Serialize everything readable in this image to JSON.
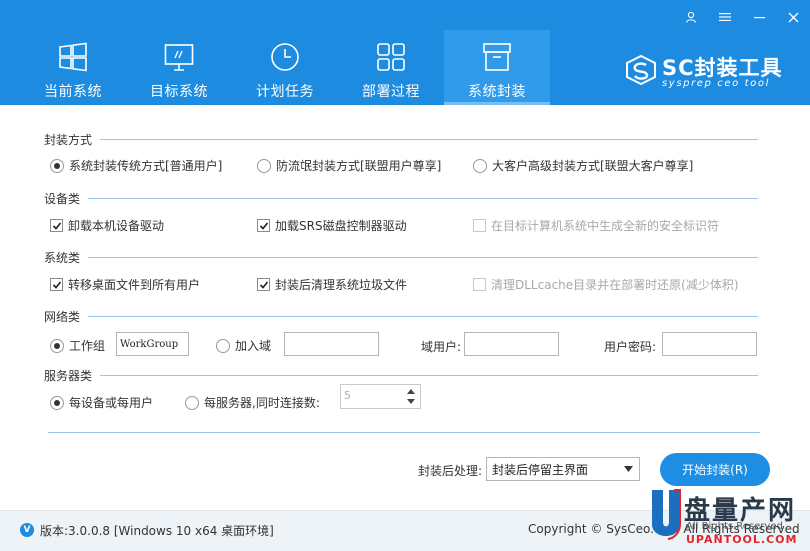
{
  "window": {
    "controls": [
      {
        "icon": "user-icon"
      },
      {
        "icon": "menu-icon"
      },
      {
        "icon": "minimize-icon"
      },
      {
        "icon": "close-icon"
      }
    ]
  },
  "tabs": [
    {
      "label": "当前系统",
      "icon": "windows-icon"
    },
    {
      "label": "目标系统",
      "icon": "monitor-icon"
    },
    {
      "label": "计划任务",
      "icon": "clock-icon"
    },
    {
      "label": "部署过程",
      "icon": "grid-icon"
    },
    {
      "label": "系统封装",
      "icon": "package-icon",
      "active": true
    }
  ],
  "brand": {
    "name": "SC封装工具",
    "sub": "sysprep ceo tool"
  },
  "sections": {
    "mode": {
      "title": "封装方式",
      "options": [
        {
          "label": "系统封装传统方式[普通用户]",
          "selected": true
        },
        {
          "label": "防流氓封装方式[联盟用户尊享]",
          "selected": false
        },
        {
          "label": "大客户高级封装方式[联盟大客户尊享]",
          "selected": false
        }
      ]
    },
    "device": {
      "title": "设备类",
      "options": [
        {
          "label": "卸载本机设备驱动",
          "checked": true,
          "disabled": false
        },
        {
          "label": "加载SRS磁盘控制器驱动",
          "checked": true,
          "disabled": false
        },
        {
          "label": "在目标计算机系统中生成全新的安全标识符",
          "checked": false,
          "disabled": true
        }
      ]
    },
    "system": {
      "title": "系统类",
      "options": [
        {
          "label": "转移桌面文件到所有用户",
          "checked": true,
          "disabled": false
        },
        {
          "label": "封装后清理系统垃圾文件",
          "checked": true,
          "disabled": false
        },
        {
          "label": "清理DLLcache目录并在部署时还原(减少体积)",
          "checked": false,
          "disabled": true
        }
      ]
    },
    "network": {
      "title": "网络类",
      "workgroup_label": "工作组",
      "workgroup_value": "WorkGroup",
      "domain_label": "加入域",
      "domain_value": "",
      "domain_user_label": "域用户:",
      "domain_user_value": "",
      "password_label": "用户密码:",
      "password_value": ""
    },
    "server": {
      "title": "服务器类",
      "per_device_label": "每设备或每用户",
      "per_server_label": "每服务器,同时连接数:",
      "connections": "5"
    }
  },
  "after": {
    "label": "封装后处理:",
    "selected": "封装后停留主界面"
  },
  "start_button": "开始封装(R)",
  "footer": {
    "version_icon": "V",
    "version": "版本:3.0.0.8 [Windows 10 x64 桌面环境]",
    "copyright": "Copyright © SysCeo.com All Rights Reserved"
  },
  "watermark": {
    "name": "盘量产网",
    "rights": "All Rights Reserved",
    "url": "UPANTOOL.COM"
  },
  "colors": {
    "accent": "#1c8be0",
    "active_tab": "#2f9bea",
    "button": "#1e8ee4",
    "watermark_red": "#e3262c"
  }
}
